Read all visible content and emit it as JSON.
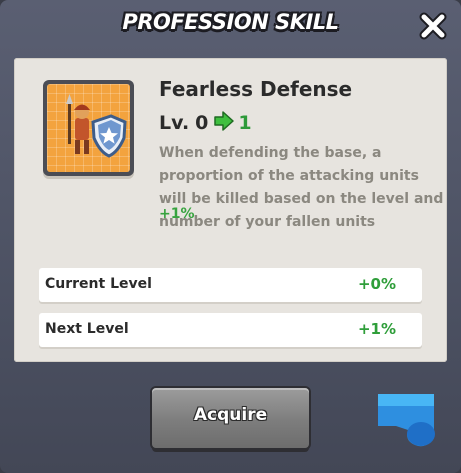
{
  "dialog": {
    "title": "PROFESSION SKILL",
    "close_icon": "close-x-icon"
  },
  "skill": {
    "icon": "shielded-soldier-icon",
    "name": "Fearless Defense",
    "level_label": "Lv.",
    "level_current": "0",
    "level_next": "1",
    "description": "When defending the base, a proportion of the attacking units will be killed based on the level and number of your fallen units",
    "bonus": "+1%"
  },
  "stats": [
    {
      "label": "Current Level",
      "value": "+0%"
    },
    {
      "label": "Next Level",
      "value": "+1%"
    }
  ],
  "actions": {
    "acquire_label": "Acquire",
    "side_item_icon": "blue-item-icon"
  },
  "colors": {
    "dialog_bg": "#4f5466",
    "panel_bg": "#e7e4df",
    "accent_green": "#2f9e3a",
    "icon_orange": "#f3a33e",
    "button_gray": "#8a8a8a",
    "item_blue": "#2e8fe0"
  }
}
